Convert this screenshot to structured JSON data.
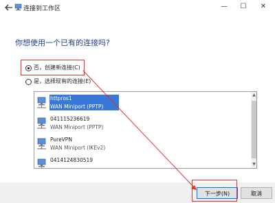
{
  "window": {
    "title": "连接到工作区"
  },
  "titlebar_controls": {
    "minimize": "—",
    "maximize": "☐",
    "close": "✕"
  },
  "heading": "你想使用一个已有的连接吗?",
  "options": [
    {
      "label": "否，创建新连接(C)",
      "selected": true
    },
    {
      "label": "是，选择现有的连接(E)",
      "selected": false
    }
  ],
  "connections": [
    {
      "name": "httpros1",
      "type": "WAN Miniport (PPTP)",
      "selected": true
    },
    {
      "name": "041115236619",
      "type": "WAN Miniport (PPTP)",
      "selected": false
    },
    {
      "name": "PureVPN",
      "type": "WAN Miniport (IKEv2)",
      "selected": false
    },
    {
      "name": "0414124830519",
      "type": "",
      "selected": false
    }
  ],
  "buttons": {
    "next": "下一步(N)",
    "cancel": "取消"
  },
  "colors": {
    "heading": "#1f3f8c",
    "selection": "#3778d9",
    "annotation": "#e03030"
  }
}
